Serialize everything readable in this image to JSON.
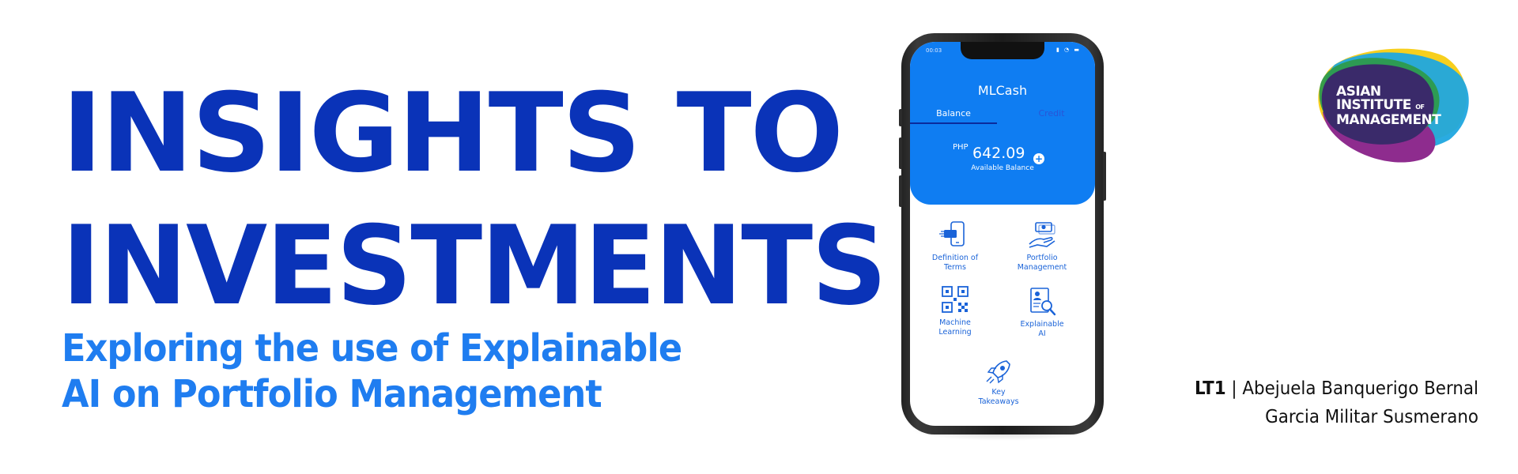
{
  "headline": {
    "line1": "INSIGHTS TO",
    "line2": "INVESTMENTS"
  },
  "subtitle": {
    "line1": "Exploring the use of Explainable",
    "line2": "AI on Portfolio Management"
  },
  "colors": {
    "headline": "#0a33b8",
    "subtitle": "#1f7df0",
    "app_primary": "#0f7df2",
    "app_icon": "#1a63d8"
  },
  "phone": {
    "status_time": "00:03",
    "app_title": "MLCash",
    "tabs": [
      {
        "label": "Balance",
        "active": true
      },
      {
        "label": "Credit",
        "active": false
      }
    ],
    "balance": {
      "currency": "PHP",
      "amount": "642.09",
      "caption": "Available Balance"
    },
    "menu": [
      {
        "line1": "Definition of",
        "line2": "Terms",
        "icon": "phone-transfer-icon"
      },
      {
        "line1": "Portfolio",
        "line2": "Management",
        "icon": "hand-money-icon"
      },
      {
        "line1": "Machine",
        "line2": "Learning",
        "icon": "qr-code-icon"
      },
      {
        "line1": "Explainable",
        "line2": "AI",
        "icon": "document-search-icon"
      },
      {
        "line1": "Key",
        "line2": "Takeaways",
        "icon": "rocket-icon"
      }
    ]
  },
  "logo": {
    "line1": "ASIAN",
    "line2": "INSTITUTE",
    "of": "OF",
    "line3": "MANAGEMENT"
  },
  "authors": {
    "group": "LT1",
    "separator": " | ",
    "line1": "Abejuela Banquerigo Bernal",
    "line2": "Garcia Militar Susmerano"
  }
}
